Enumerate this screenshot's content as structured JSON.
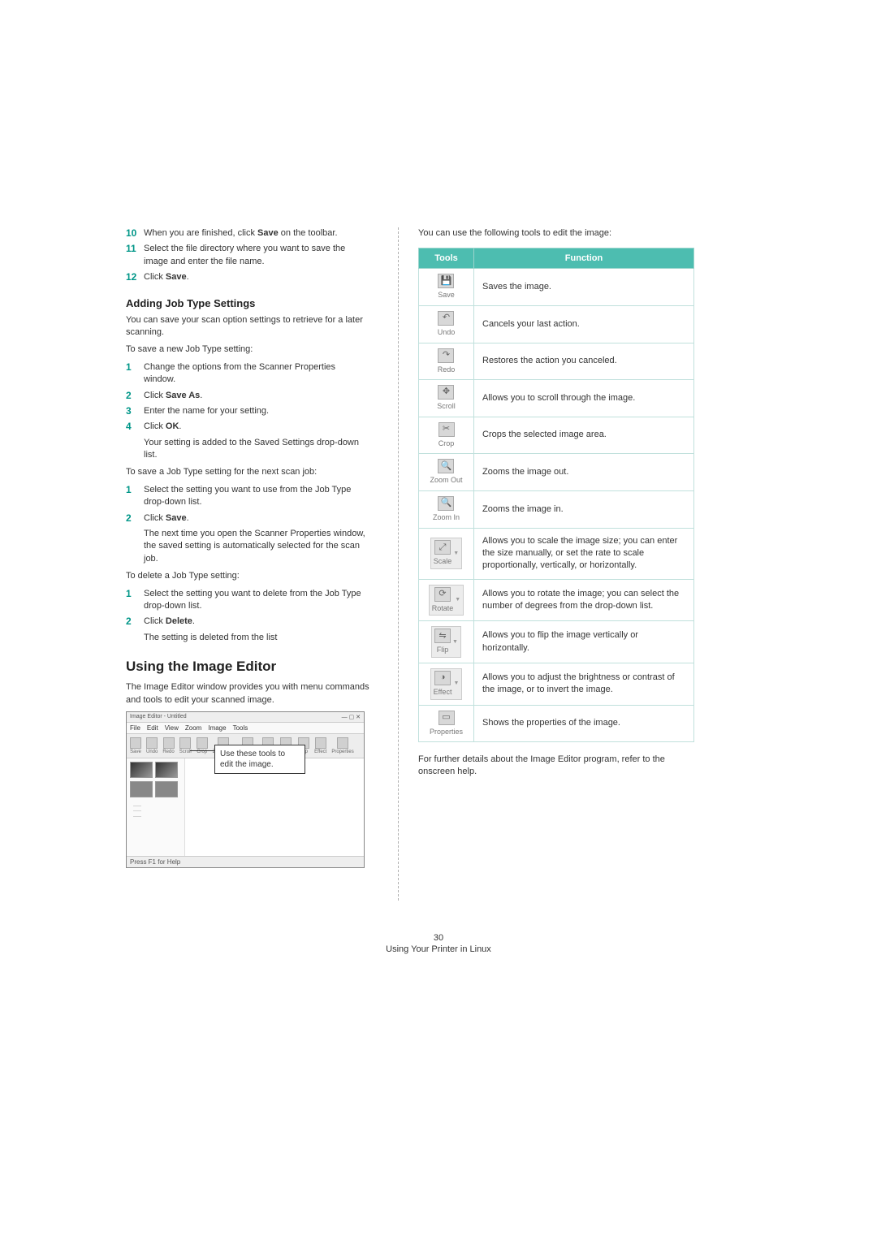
{
  "steps_top": [
    {
      "num": "10",
      "html": "When you are finished, click <b>Save</b> on the toolbar."
    },
    {
      "num": "11",
      "html": "Select the file directory where you want to save the image and enter the file name."
    },
    {
      "num": "12",
      "html": "Click <b>Save</b>."
    }
  ],
  "adding": {
    "title": "Adding Job Type Settings",
    "intro": "You can save your scan option settings to retrieve for a later scanning.",
    "saveNew": "To save a new Job Type setting:",
    "saveSteps": [
      {
        "num": "1",
        "html": "Change the options from the Scanner Properties window."
      },
      {
        "num": "2",
        "html": "Click <b>Save As</b>."
      },
      {
        "num": "3",
        "html": "Enter the name for your setting."
      },
      {
        "num": "4",
        "html": "Click <b>OK</b>."
      }
    ],
    "saveNote": "Your setting is added to the Saved Settings drop-down list.",
    "nextJob": "To save a Job Type setting for the next scan job:",
    "nextSteps": [
      {
        "num": "1",
        "html": "Select the setting you want to use from the Job Type drop-down list."
      },
      {
        "num": "2",
        "html": "Click <b>Save</b>."
      }
    ],
    "nextNote": "The next time you open the Scanner Properties window, the saved setting is automatically selected for the scan job.",
    "delete": "To delete a Job Type setting:",
    "deleteSteps": [
      {
        "num": "1",
        "html": "Select the setting you want to delete from the Job Type drop-down list."
      },
      {
        "num": "2",
        "html": "Click <b>Delete</b>."
      }
    ],
    "deleteNote": "The setting is deleted from the list"
  },
  "editor": {
    "title": "Using the Image Editor",
    "desc": "The Image Editor window provides you with menu commands and tools to edit your scanned image."
  },
  "ss": {
    "winTitle": "Image Editor - Untitled",
    "menu": [
      "File",
      "Edit",
      "View",
      "Zoom",
      "Image",
      "Tools"
    ],
    "toolbar": [
      "Save",
      "Undo",
      "Redo",
      "Scroll",
      "Crop",
      "Zoom Out",
      "Zoom In",
      "Scale",
      "Rotate",
      "Flip",
      "Effect",
      "Properties"
    ],
    "callout": "Use these tools to edit the image.",
    "status": "Press F1 for Help"
  },
  "table": {
    "intro": "You can use the following tools to edit the image:",
    "header": [
      "Tools",
      "Function"
    ],
    "rows": [
      {
        "icon": "save-icon",
        "glyph": "💾",
        "label": "Save",
        "func": "Saves the image.",
        "wide": false
      },
      {
        "icon": "undo-icon",
        "glyph": "↶",
        "label": "Undo",
        "func": "Cancels your last action.",
        "wide": false
      },
      {
        "icon": "redo-icon",
        "glyph": "↷",
        "label": "Redo",
        "func": "Restores the action you canceled.",
        "wide": false
      },
      {
        "icon": "scroll-icon",
        "glyph": "✥",
        "label": "Scroll",
        "func": "Allows you to scroll through the image.",
        "wide": false
      },
      {
        "icon": "crop-icon",
        "glyph": "✂",
        "label": "Crop",
        "func": "Crops the selected image area.",
        "wide": false
      },
      {
        "icon": "zoom-out-icon",
        "glyph": "🔍",
        "label": "Zoom Out",
        "func": "Zooms the image out.",
        "wide": false
      },
      {
        "icon": "zoom-in-icon",
        "glyph": "🔍",
        "label": "Zoom In",
        "func": "Zooms the image in.",
        "wide": false
      },
      {
        "icon": "scale-icon",
        "glyph": "⤢",
        "label": "Scale",
        "func": "Allows you to scale the image size; you can enter the size manually, or set the rate to scale proportionally, vertically, or horizontally.",
        "wide": true
      },
      {
        "icon": "rotate-icon",
        "glyph": "⟳",
        "label": "Rotate",
        "func": "Allows you to rotate the image; you can select the number of degrees from the drop-down list.",
        "wide": true
      },
      {
        "icon": "flip-icon",
        "glyph": "⇋",
        "label": "Flip",
        "func": "Allows you to flip the image vertically or horizontally.",
        "wide": true
      },
      {
        "icon": "effect-icon",
        "glyph": "◑",
        "label": "Effect",
        "func": "Allows you to adjust the brightness or contrast of the image, or to invert the image.",
        "wide": true
      },
      {
        "icon": "properties-icon",
        "glyph": "▭",
        "label": "Properties",
        "func": "Shows the properties of the image.",
        "wide": false
      }
    ],
    "note": "For further details about the Image Editor program, refer to the onscreen help."
  },
  "footer": {
    "num": "30",
    "caption": "Using Your Printer in Linux"
  }
}
